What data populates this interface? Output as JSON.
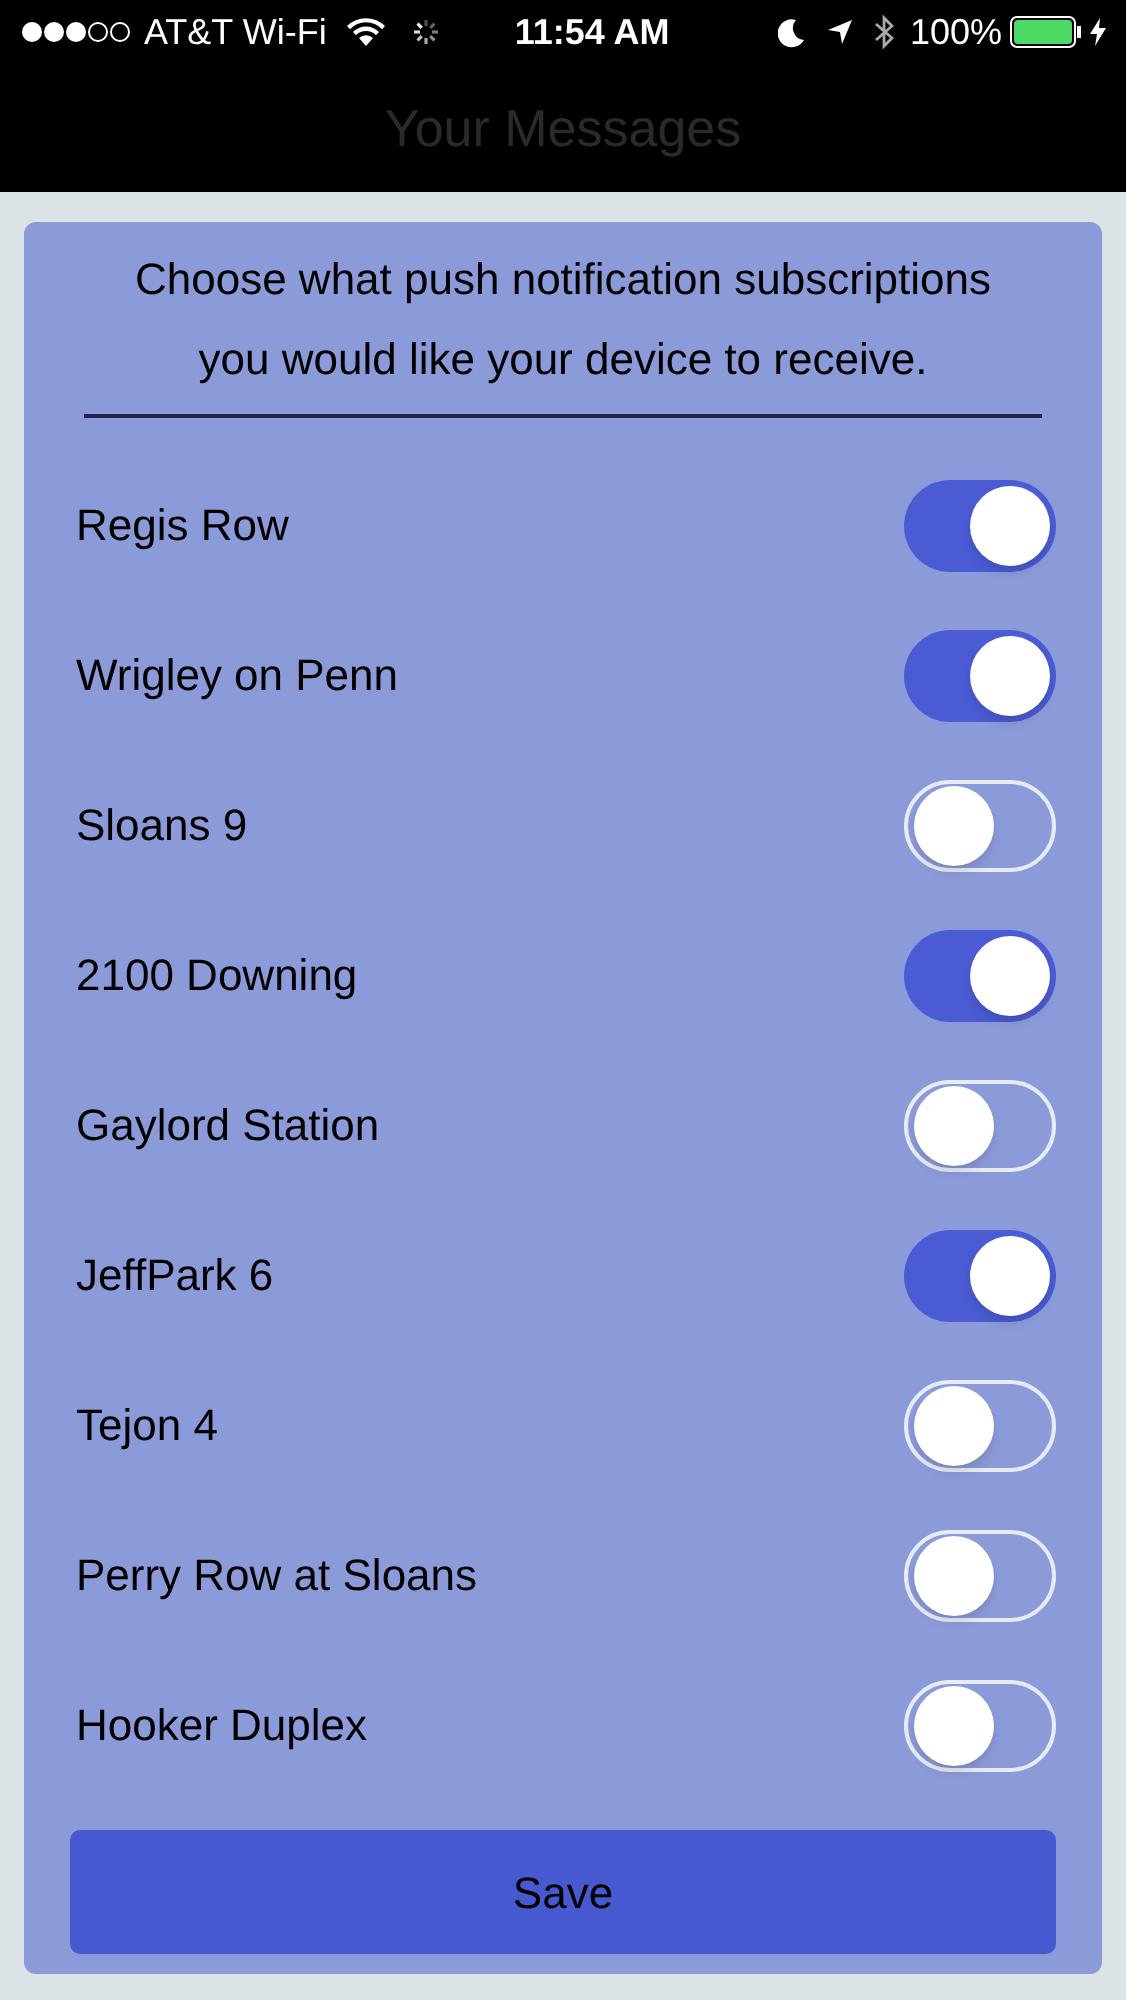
{
  "status_bar": {
    "carrier": "AT&T Wi-Fi",
    "time": "11:54 AM",
    "battery": "100%"
  },
  "nav_bar": {
    "title": "Your Messages"
  },
  "dialog": {
    "prompt": "Choose what push notification subscriptions you would like your device to receive.",
    "subscriptions": [
      {
        "name": "Regis Row",
        "on": true
      },
      {
        "name": "Wrigley on Penn",
        "on": true
      },
      {
        "name": "Sloans 9",
        "on": false
      },
      {
        "name": "2100 Downing",
        "on": true
      },
      {
        "name": "Gaylord Station",
        "on": false
      },
      {
        "name": "JeffPark 6",
        "on": true
      },
      {
        "name": "Tejon 4",
        "on": false
      },
      {
        "name": "Perry Row at Sloans",
        "on": false
      },
      {
        "name": "Hooker Duplex",
        "on": false
      }
    ],
    "button": "Save"
  }
}
